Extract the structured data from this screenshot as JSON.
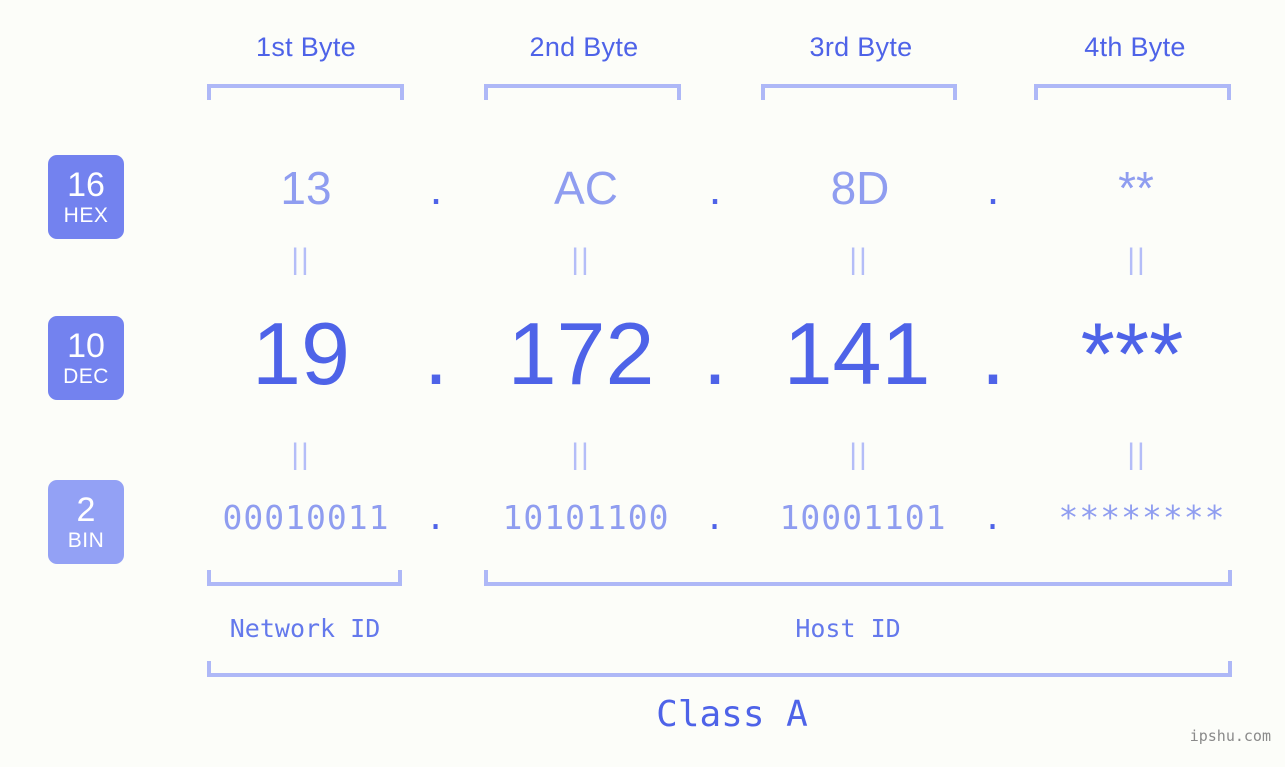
{
  "meta": {
    "background_color": "#fcfdf9",
    "accent_strong": "#4e63e8",
    "accent_light": "#8f9df0",
    "bracket_color": "#aeb8f7",
    "badge_color": "#7382ef",
    "badge_color_light": "#93a1f5"
  },
  "headers": [
    {
      "label": "1st Byte"
    },
    {
      "label": "2nd Byte"
    },
    {
      "label": "3rd Byte"
    },
    {
      "label": "4th Byte"
    }
  ],
  "bases": [
    {
      "number": "16",
      "name": "HEX"
    },
    {
      "number": "10",
      "name": "DEC"
    },
    {
      "number": "2",
      "name": "BIN"
    }
  ],
  "separators": {
    "dot": ".",
    "equals": "||"
  },
  "rows": {
    "hex": {
      "base_number": "16",
      "base_name": "HEX",
      "values": [
        "13",
        "AC",
        "8D",
        "**"
      ]
    },
    "dec": {
      "base_number": "10",
      "base_name": "DEC",
      "values": [
        "19",
        "172",
        "141",
        "***"
      ]
    },
    "bin": {
      "base_number": "2",
      "base_name": "BIN",
      "values": [
        "00010011",
        "10101100",
        "10001101",
        "********"
      ]
    }
  },
  "footer": {
    "network_id_label": "Network ID",
    "host_id_label": "Host ID",
    "class_label": "Class A",
    "watermark": "ipshu.com"
  }
}
